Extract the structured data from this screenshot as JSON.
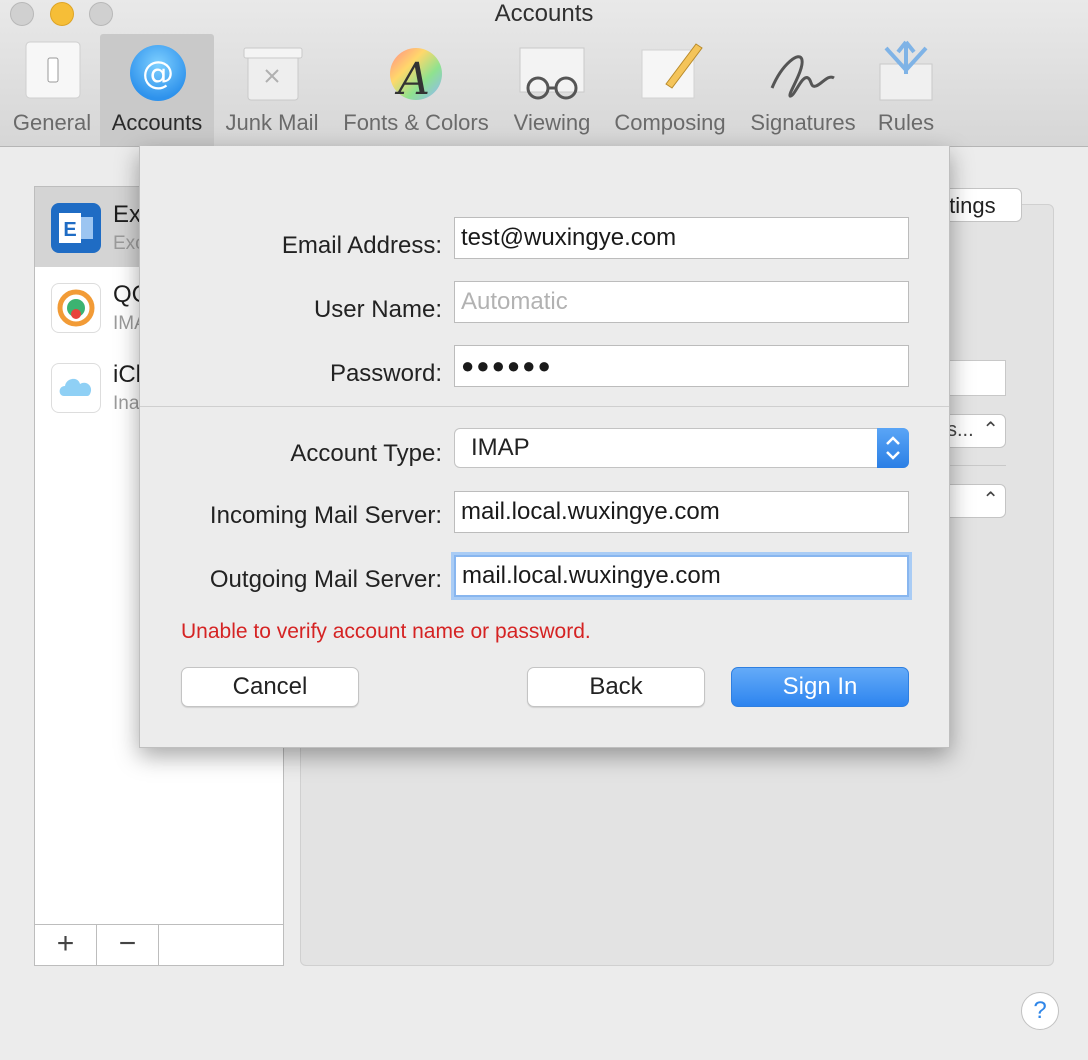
{
  "window": {
    "title": "Accounts"
  },
  "toolbar": {
    "items": [
      {
        "label": "General"
      },
      {
        "label": "Accounts"
      },
      {
        "label": "Junk Mail"
      },
      {
        "label": "Fonts & Colors"
      },
      {
        "label": "Viewing"
      },
      {
        "label": "Composing"
      },
      {
        "label": "Signatures"
      },
      {
        "label": "Rules"
      }
    ],
    "selected": "Accounts"
  },
  "accounts_list": {
    "items": [
      {
        "name": "Ex",
        "subtitle": "Exc"
      },
      {
        "name": "QC",
        "subtitle": "IMA"
      },
      {
        "name": "iCl",
        "subtitle": "Ina"
      }
    ],
    "add_label": "+",
    "remove_label": "−"
  },
  "background": {
    "settings_button": "ttings",
    "popup_label": "s..."
  },
  "sheet": {
    "email": {
      "label": "Email Address:",
      "value": "test@wuxingye.com"
    },
    "username": {
      "label": "User Name:",
      "placeholder": "Automatic",
      "value": ""
    },
    "password": {
      "label": "Password:",
      "value": "●●●●●●"
    },
    "account_type": {
      "label": "Account Type:",
      "value": "IMAP"
    },
    "incoming": {
      "label": "Incoming Mail Server:",
      "value": "mail.local.wuxingye.com"
    },
    "outgoing": {
      "label": "Outgoing Mail Server:",
      "value": "mail.local.wuxingye.com"
    },
    "error": "Unable to verify account name or password.",
    "buttons": {
      "cancel": "Cancel",
      "back": "Back",
      "sign_in": "Sign In"
    }
  },
  "help": {
    "label": "?"
  },
  "colors": {
    "accent": "#2f86e8",
    "error": "#d52323",
    "traffic_min": "#f6be37"
  }
}
